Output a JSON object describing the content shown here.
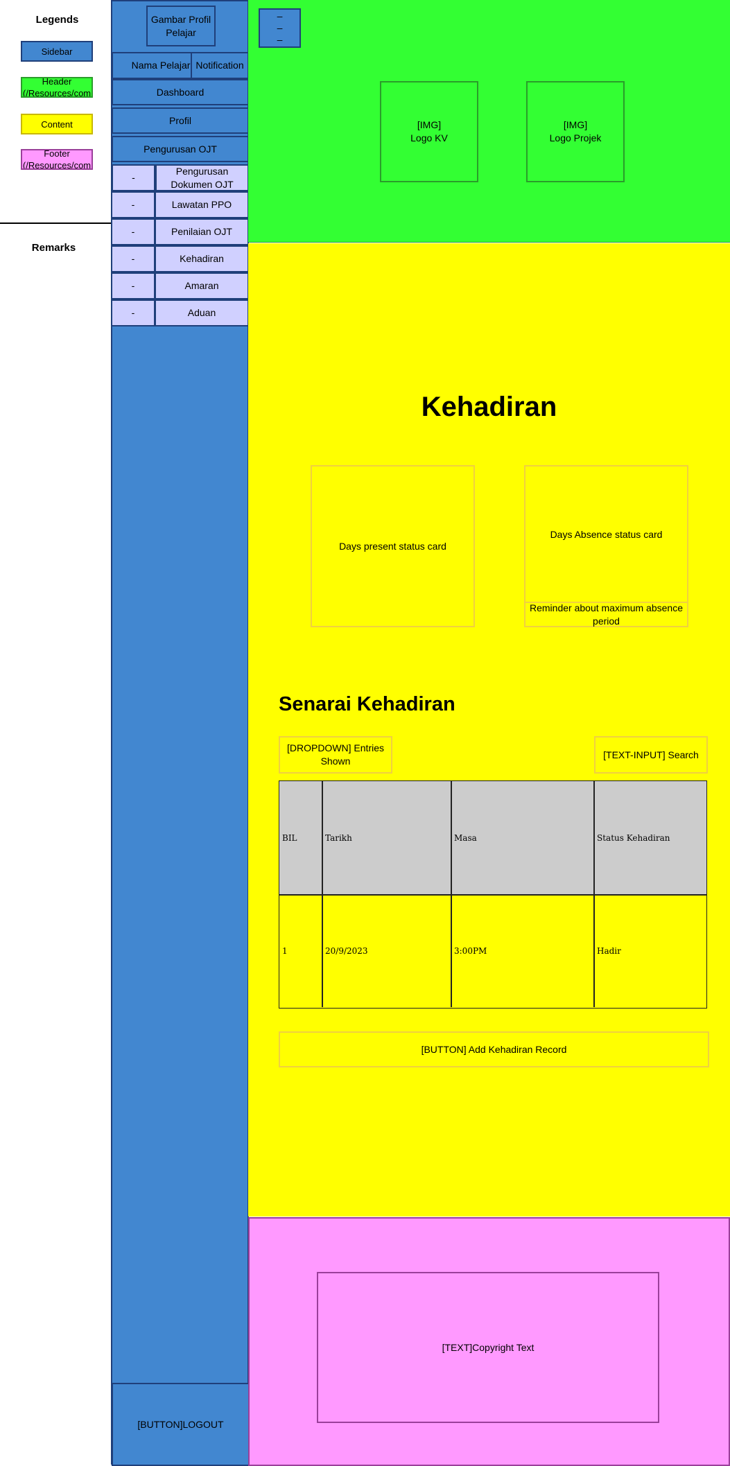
{
  "legend": {
    "title": "Legends",
    "items": [
      {
        "label": "Sidebar",
        "color": "#4287d0"
      },
      {
        "label": "Header (/Resources/com",
        "color": "#33ff33"
      },
      {
        "label": "Content",
        "color": "#ffff00"
      },
      {
        "label": "Footer (/Resources/com",
        "color": "#ff99ff"
      }
    ],
    "remarks_title": "Remarks"
  },
  "sidebar": {
    "profile_image": "Gambar Profil Pelajar",
    "student_name": "Nama Pelajar",
    "notification": "Notification",
    "menu": [
      "Dashboard",
      "Profil",
      "Pengurusan OJT"
    ],
    "submenu_marker": "-",
    "submenu": [
      "Pengurusan Dokumen OJT",
      "Lawatan PPO",
      "Penilaian OJT",
      "Kehadiran",
      "Amaran",
      "Aduan"
    ],
    "logout": "[BUTTON]LOGOUT"
  },
  "header": {
    "hamburger_lines": [
      "–",
      "–",
      "–"
    ],
    "logo_kv": {
      "tag": "[IMG]",
      "label": "Logo KV"
    },
    "logo_projek": {
      "tag": "[IMG]",
      "label": "Logo Projek"
    }
  },
  "content": {
    "page_title": "Kehadiran",
    "present_card": "Days present status card",
    "absence_card": "Days Absence status card",
    "absence_reminder": "Reminder about maximum absence period",
    "list_title": "Senarai Kehadiran",
    "entries_dropdown": "[DROPDOWN] Entries Shown",
    "search_input": "[TEXT-INPUT] Search",
    "table": {
      "headers": [
        "BIL",
        "Tarikh",
        "Masa",
        "Status Kehadiran"
      ],
      "rows": [
        [
          "1",
          "20/9/2023",
          "3:00PM",
          "Hadir"
        ]
      ]
    },
    "add_button": "[BUTTON] Add Kehadiran Record"
  },
  "footer": {
    "copyright": "[TEXT]Copyright Text"
  },
  "colors": {
    "sidebar": "#4287d0",
    "header": "#33ff33",
    "content": "#ffff00",
    "footer": "#ff99ff",
    "submenu": "#d0d0ff"
  }
}
